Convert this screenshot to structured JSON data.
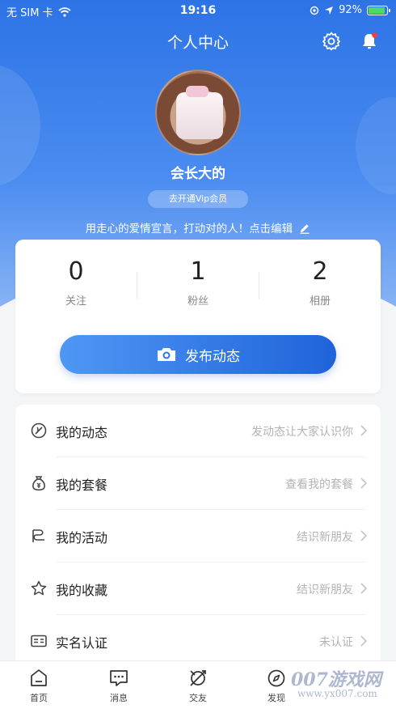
{
  "status_bar": {
    "carrier": "无 SIM 卡",
    "time": "19:16",
    "battery": "92%",
    "battery_level": 0.92
  },
  "header": {
    "title": "个人中心"
  },
  "profile": {
    "username": "会长大的",
    "vip_label": "去开通Vip会员",
    "bio": "用走心的爱情宣言，打动对的人！点击编辑"
  },
  "stats": [
    {
      "value": "0",
      "label": "关注"
    },
    {
      "value": "1",
      "label": "粉丝"
    },
    {
      "value": "2",
      "label": "相册"
    }
  ],
  "publish_button": {
    "label": "发布动态"
  },
  "menu": [
    {
      "label": "我的动态",
      "hint": "发动态让大家认识你",
      "icon": "post-icon"
    },
    {
      "label": "我的套餐",
      "hint": "查看我的套餐",
      "icon": "money-bag-icon"
    },
    {
      "label": "我的活动",
      "hint": "结识新朋友",
      "icon": "activity-icon"
    },
    {
      "label": "我的收藏",
      "hint": "结识新朋友",
      "icon": "star-icon"
    },
    {
      "label": "实名认证",
      "hint": "未认证",
      "icon": "id-card-icon"
    }
  ],
  "tabs": [
    {
      "label": "首页",
      "icon": "home-icon"
    },
    {
      "label": "消息",
      "icon": "message-icon"
    },
    {
      "label": "交友",
      "icon": "dating-icon"
    },
    {
      "label": "发现",
      "icon": "compass-icon"
    }
  ],
  "watermark": {
    "main": "007游戏网",
    "sub": "www.yx007.com"
  },
  "colors": {
    "accent": "#2d73e6",
    "button_start": "#4f97f4",
    "button_end": "#1f63da"
  }
}
